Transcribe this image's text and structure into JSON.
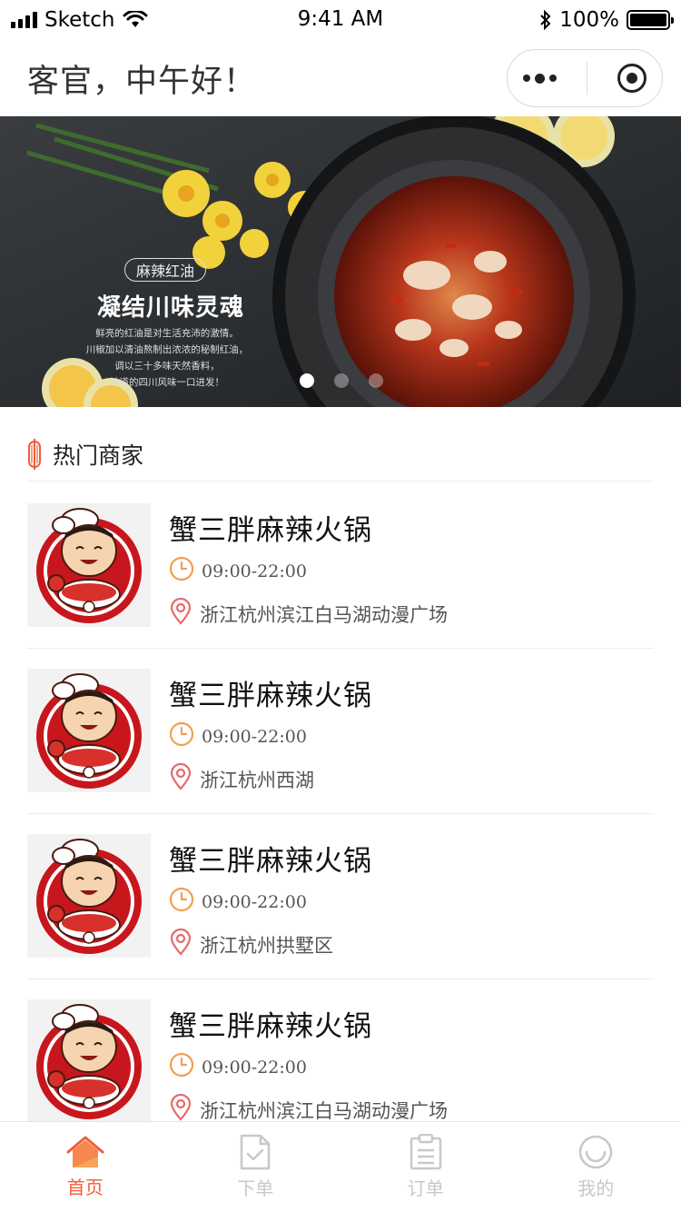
{
  "status_bar": {
    "carrier": "Sketch",
    "time": "9:41 AM",
    "battery": "100%"
  },
  "header": {
    "greeting": "客官，中午好！"
  },
  "banner": {
    "tag": "麻辣红油",
    "title": "凝结川味灵魂",
    "description_lines": [
      "鲜亮的红油是对生活充沛的激情。",
      "川椒加以清油熬制出浓浓的秘制红油，",
      "调以三十多味天然香料，",
      "地道的四川风味一口进发！"
    ],
    "slides": 3,
    "active_slide": 1
  },
  "section": {
    "title": "热门商家"
  },
  "shops": [
    {
      "name": "蟹三胖麻辣火锅",
      "hours": "09:00-22:00",
      "address": "浙江杭州滨江白马湖动漫广场"
    },
    {
      "name": "蟹三胖麻辣火锅",
      "hours": "09:00-22:00",
      "address": "浙江杭州西湖"
    },
    {
      "name": "蟹三胖麻辣火锅",
      "hours": "09:00-22:00",
      "address": "浙江杭州拱墅区"
    },
    {
      "name": "蟹三胖麻辣火锅",
      "hours": "09:00-22:00",
      "address": "浙江杭州滨江白马湖动漫广场"
    }
  ],
  "tabbar": {
    "tabs": [
      {
        "label": "首页",
        "icon": "home-icon",
        "active": true
      },
      {
        "label": "下单",
        "icon": "order-doc-icon",
        "active": false
      },
      {
        "label": "订单",
        "icon": "clipboard-icon",
        "active": false
      },
      {
        "label": "我的",
        "icon": "smile-icon",
        "active": false
      }
    ]
  },
  "colors": {
    "accent": "#f25c3a",
    "clock": "#f0a050",
    "pin": "#e86a6a",
    "inactive": "#c8c8c8"
  }
}
